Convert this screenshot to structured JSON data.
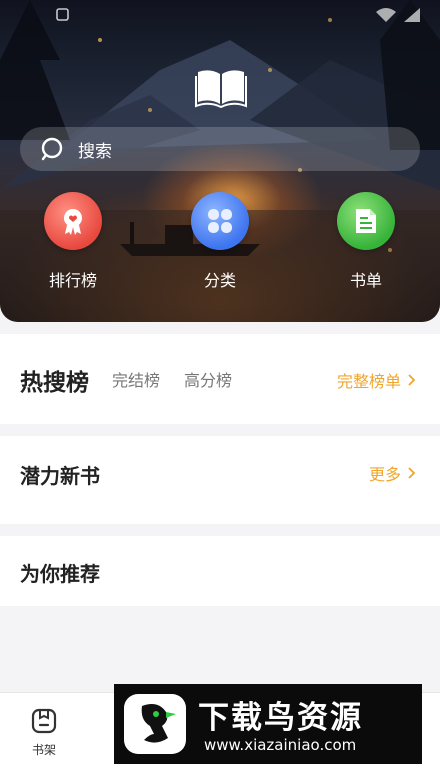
{
  "header": {
    "search_placeholder": "搜索",
    "icons": {
      "logo": "open-book-icon",
      "search": "search-icon"
    }
  },
  "features": [
    {
      "label": "排行榜",
      "icon": "ranking-medal-icon",
      "color": "#e8493f"
    },
    {
      "label": "分类",
      "icon": "category-grid-icon",
      "color": "#3d74ef"
    },
    {
      "label": "书单",
      "icon": "booklist-icon",
      "color": "#36b339"
    }
  ],
  "hot_search": {
    "title": "热搜榜",
    "tabs": [
      "完结榜",
      "高分榜"
    ],
    "more_label": "完整榜单"
  },
  "potential_new": {
    "title": "潜力新书",
    "more_label": "更多"
  },
  "recommend": {
    "title": "为你推荐"
  },
  "bottom_nav": {
    "items": [
      {
        "label": "书架",
        "icon": "bookshelf-icon"
      }
    ]
  },
  "watermark": {
    "title": "下载鸟资源",
    "url": "www.xiazainiao.com"
  },
  "colors": {
    "accent": "#f0a52c",
    "title_text": "#222222",
    "tab_text": "#777777"
  }
}
